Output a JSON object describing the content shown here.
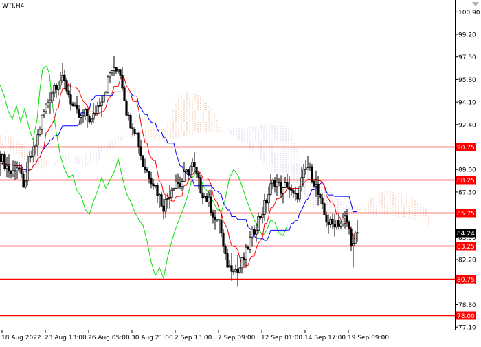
{
  "header": {
    "symbol_label": "WTI,H4"
  },
  "chart_data": {
    "type": "candlestick",
    "symbol": "WTI",
    "timeframe": "H4",
    "ylim": [
      76.9,
      101.8
    ],
    "y_ticks": [
      "100.90",
      "99.20",
      "97.50",
      "95.80",
      "94.10",
      "92.40",
      "90.75",
      "89.00",
      "87.30",
      "85.60",
      "83.90",
      "82.20",
      "80.50",
      "78.80",
      "77.10"
    ],
    "x_ticks": [
      "18 Aug 2022",
      "23 Aug 13:00",
      "26 Aug 05:00",
      "30 Aug 21:00",
      "2 Sep 13:00",
      "7 Sep 09:00",
      "12 Sep 01:00",
      "14 Sep 17:00",
      "19 Sep 09:00"
    ],
    "current_price": {
      "value": 84.24,
      "label": "84.24"
    },
    "horizontal_levels": [
      {
        "value": 90.75,
        "label": "90.75"
      },
      {
        "value": 88.25,
        "label": "88.25"
      },
      {
        "value": 85.75,
        "label": "85.75"
      },
      {
        "value": 83.25,
        "label": "83.25"
      },
      {
        "value": 80.75,
        "label": "80.75"
      },
      {
        "value": 78.0,
        "label": "78.00"
      }
    ],
    "anchors": [
      [
        0,
        90.2
      ],
      [
        6,
        89.6
      ],
      [
        12,
        89.1
      ],
      [
        18,
        88.6
      ],
      [
        24,
        89.4
      ],
      [
        30,
        88.9
      ],
      [
        34,
        87.2
      ],
      [
        38,
        88.6
      ],
      [
        44,
        89.8
      ],
      [
        50,
        90.4
      ],
      [
        56,
        91.6
      ],
      [
        62,
        93.0
      ],
      [
        68,
        93.8
      ],
      [
        74,
        94.6
      ],
      [
        80,
        95.4
      ],
      [
        88,
        95.8
      ],
      [
        94,
        95.6
      ],
      [
        100,
        94.8
      ],
      [
        106,
        93.8
      ],
      [
        112,
        93.2
      ],
      [
        118,
        92.8
      ],
      [
        126,
        93.2
      ],
      [
        134,
        92.6
      ],
      [
        140,
        93.5
      ],
      [
        146,
        94.2
      ],
      [
        152,
        94.8
      ],
      [
        156,
        95.4
      ],
      [
        160,
        96.2
      ],
      [
        164,
        96.6
      ],
      [
        168,
        96.2
      ],
      [
        172,
        96.9
      ],
      [
        176,
        96.2
      ],
      [
        180,
        95.0
      ],
      [
        184,
        93.6
      ],
      [
        188,
        92.7
      ],
      [
        194,
        92.4
      ],
      [
        200,
        91.6
      ],
      [
        204,
        90.6
      ],
      [
        208,
        89.4
      ],
      [
        214,
        88.9
      ],
      [
        220,
        88.4
      ],
      [
        226,
        87.8
      ],
      [
        232,
        87.0
      ],
      [
        238,
        86.2
      ],
      [
        244,
        86.8
      ],
      [
        250,
        87.6
      ],
      [
        256,
        88.2
      ],
      [
        262,
        87.8
      ],
      [
        268,
        88.4
      ],
      [
        274,
        88.9
      ],
      [
        280,
        89.4
      ],
      [
        286,
        88.6
      ],
      [
        292,
        87.6
      ],
      [
        298,
        87.0
      ],
      [
        304,
        86.6
      ],
      [
        310,
        85.8
      ],
      [
        316,
        84.8
      ],
      [
        320,
        85.4
      ],
      [
        324,
        83.4
      ],
      [
        328,
        82.3
      ],
      [
        334,
        81.6
      ],
      [
        340,
        81.8
      ],
      [
        346,
        81.2
      ],
      [
        352,
        81.9
      ],
      [
        358,
        82.6
      ],
      [
        364,
        83.6
      ],
      [
        370,
        84.4
      ],
      [
        376,
        85.2
      ],
      [
        382,
        85.8
      ],
      [
        388,
        86.6
      ],
      [
        394,
        87.6
      ],
      [
        400,
        88.2
      ],
      [
        406,
        87.8
      ],
      [
        412,
        87.3
      ],
      [
        418,
        88.0
      ],
      [
        424,
        87.2
      ],
      [
        430,
        86.8
      ],
      [
        436,
        87.4
      ],
      [
        442,
        88.6
      ],
      [
        448,
        89.2
      ],
      [
        454,
        88.6
      ],
      [
        460,
        87.8
      ],
      [
        466,
        86.6
      ],
      [
        472,
        85.6
      ],
      [
        478,
        85.0
      ],
      [
        484,
        84.8
      ],
      [
        490,
        85.2
      ],
      [
        496,
        84.9
      ],
      [
        502,
        85.3
      ],
      [
        506,
        85.0
      ],
      [
        510,
        84.0
      ],
      [
        514,
        83.1
      ],
      [
        518,
        84.0
      ],
      [
        521,
        84.24
      ]
    ],
    "lagging_span": [
      [
        0,
        95.4
      ],
      [
        6,
        94.6
      ],
      [
        12,
        93.4
      ],
      [
        18,
        92.8
      ],
      [
        24,
        93.8
      ],
      [
        30,
        92.6
      ],
      [
        36,
        93.6
      ],
      [
        42,
        92.2
      ],
      [
        48,
        91.2
      ],
      [
        54,
        92.8
      ],
      [
        58,
        95.0
      ],
      [
        62,
        96.6
      ],
      [
        68,
        96.8
      ],
      [
        72,
        96.2
      ],
      [
        76,
        94.0
      ],
      [
        82,
        91.8
      ],
      [
        88,
        90.0
      ],
      [
        94,
        89.0
      ],
      [
        100,
        88.4
      ],
      [
        106,
        88.6
      ],
      [
        112,
        87.4
      ],
      [
        118,
        87.0
      ],
      [
        124,
        86.0
      ],
      [
        130,
        85.6
      ],
      [
        136,
        86.6
      ],
      [
        142,
        87.4
      ],
      [
        148,
        88.4
      ],
      [
        154,
        87.6
      ],
      [
        160,
        88.2
      ],
      [
        166,
        88.8
      ],
      [
        172,
        89.8
      ],
      [
        178,
        88.4
      ],
      [
        184,
        87.2
      ],
      [
        190,
        86.6
      ],
      [
        196,
        85.8
      ],
      [
        202,
        85.2
      ],
      [
        208,
        84.8
      ],
      [
        214,
        83.6
      ],
      [
        220,
        82.0
      ],
      [
        226,
        81.0
      ],
      [
        232,
        81.6
      ],
      [
        238,
        80.8
      ],
      [
        244,
        82.4
      ],
      [
        250,
        83.6
      ],
      [
        256,
        84.6
      ],
      [
        262,
        85.4
      ],
      [
        268,
        86.2
      ],
      [
        274,
        87.2
      ],
      [
        280,
        88.4
      ],
      [
        286,
        88.8
      ],
      [
        292,
        88.2
      ],
      [
        298,
        87.6
      ],
      [
        304,
        87.2
      ],
      [
        310,
        86.6
      ],
      [
        316,
        86.0
      ],
      [
        322,
        85.8
      ],
      [
        328,
        86.8
      ],
      [
        334,
        88.4
      ],
      [
        340,
        89.0
      ],
      [
        346,
        88.6
      ],
      [
        352,
        87.8
      ],
      [
        358,
        86.8
      ],
      [
        364,
        86.0
      ],
      [
        370,
        85.2
      ],
      [
        376,
        84.6
      ],
      [
        382,
        84.0
      ],
      [
        388,
        84.4
      ],
      [
        394,
        85.2
      ],
      [
        400,
        85.0
      ],
      [
        406,
        84.2
      ],
      [
        412,
        84.0
      ],
      [
        418,
        84.8
      ]
    ],
    "cloud": [
      [
        0,
        91.6,
        90.8
      ],
      [
        20,
        91.4,
        90.4
      ],
      [
        40,
        90.6,
        89.6
      ],
      [
        60,
        89.8,
        89.0
      ],
      [
        80,
        89.4,
        89.6
      ],
      [
        100,
        89.8,
        90.2
      ],
      [
        120,
        89.2,
        90.0
      ],
      [
        140,
        89.6,
        90.6
      ],
      [
        160,
        90.6,
        91.2
      ],
      [
        180,
        91.4,
        91.6
      ],
      [
        200,
        91.8,
        91.2
      ],
      [
        220,
        92.0,
        91.4
      ],
      [
        240,
        92.0,
        91.0
      ],
      [
        260,
        94.6,
        91.4
      ],
      [
        272,
        94.8,
        91.6
      ],
      [
        290,
        94.6,
        91.8
      ],
      [
        310,
        93.4,
        91.8
      ],
      [
        320,
        92.2,
        91.8
      ],
      [
        340,
        91.6,
        92.2
      ],
      [
        360,
        90.8,
        92.2
      ],
      [
        380,
        89.8,
        92.4
      ],
      [
        400,
        88.8,
        92.4
      ],
      [
        420,
        88.0,
        92.2
      ],
      [
        440,
        87.2,
        89.4
      ],
      [
        460,
        86.0,
        88.8
      ],
      [
        480,
        85.2,
        87.4
      ],
      [
        500,
        85.4,
        86.4
      ],
      [
        520,
        85.8,
        86.0
      ],
      [
        540,
        86.8,
        85.6
      ],
      [
        560,
        87.4,
        85.6
      ],
      [
        580,
        87.2,
        85.4
      ],
      [
        600,
        86.8,
        85.2
      ],
      [
        620,
        86.0,
        84.8
      ],
      [
        626,
        85.6,
        84.6
      ]
    ]
  }
}
